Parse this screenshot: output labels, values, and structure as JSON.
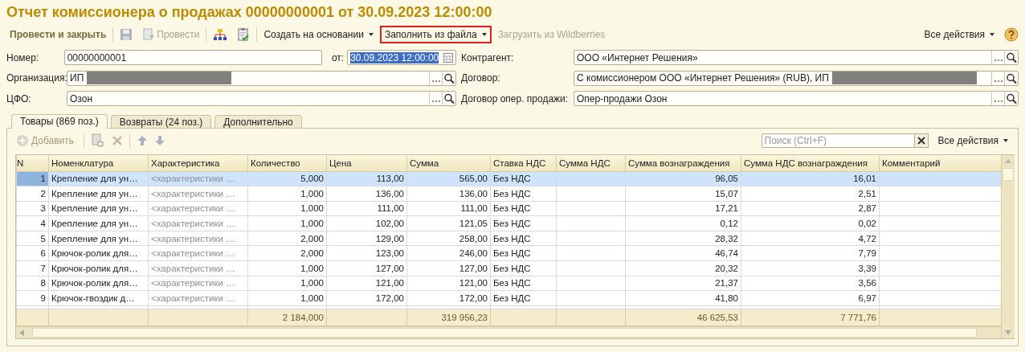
{
  "title": "Отчет комиссионера о продажах 00000000001 от 30.09.2023 12:00:00",
  "toolbar": {
    "items": [
      {
        "kind": "primary",
        "label": "Провести и закрыть",
        "disabled": false,
        "highlighted": false
      },
      {
        "kind": "save",
        "disabled": true,
        "highlighted": false
      },
      {
        "kind": "post",
        "label": "Провести",
        "disabled": true,
        "highlighted": false
      },
      {
        "kind": "structure",
        "disabled": false,
        "highlighted": false
      },
      {
        "kind": "report",
        "disabled": false,
        "highlighted": false
      },
      {
        "kind": "menu",
        "label": "Создать на основании",
        "disabled": false,
        "highlighted": false
      },
      {
        "kind": "menu",
        "label": "Заполнить из файла",
        "disabled": false,
        "highlighted": true
      },
      {
        "kind": "link",
        "label": "Загрузить из Wildberries",
        "disabled": true,
        "highlighted": false
      }
    ],
    "all_actions": "Все действия"
  },
  "fields_left": [
    {
      "label": "Номер:",
      "value": "00000000001",
      "kind": "number",
      "date_label": "от:",
      "date_value": "30.09.2023 12:00:00",
      "date_selected": true
    },
    {
      "label": "Организация:",
      "value": "ИП",
      "kind": "ref",
      "redacted": true
    },
    {
      "label": "ЦФО:",
      "value": "Озон",
      "kind": "ref",
      "redacted": false
    }
  ],
  "fields_right": [
    {
      "label": "Контрагент:",
      "value": "ООО «Интернет Решения»",
      "redacted": false
    },
    {
      "label": "Договор:",
      "value": "С комиссионером ООО «Интернет Решения» (RUB), ИП",
      "redacted": true
    },
    {
      "label": "Договор опер. продажи:",
      "value": "Опер-продажи Озон",
      "redacted": false
    }
  ],
  "tabs": [
    {
      "label": "Товары (869 поз.)",
      "selected": true
    },
    {
      "label": "Возвраты (24 поз.)",
      "selected": false
    },
    {
      "label": "Дополнительно",
      "selected": false
    }
  ],
  "table_toolbar": {
    "add": {
      "label": "Добавить",
      "disabled": true
    },
    "icons": [
      {
        "kind": "copy",
        "disabled": true
      },
      {
        "kind": "delete",
        "disabled": true
      },
      {
        "kind": "up",
        "disabled": true
      },
      {
        "kind": "down",
        "disabled": true
      }
    ],
    "search": {
      "placeholder": "Поиск (Ctrl+F)"
    },
    "all_actions": "Все действия"
  },
  "table": {
    "columns": [
      {
        "label": "N",
        "kind": "index"
      },
      {
        "label": "Номенклатура",
        "kind": "text"
      },
      {
        "label": "Характеристика",
        "kind": "hint"
      },
      {
        "label": "Количество",
        "kind": "number",
        "total": "2 184,000"
      },
      {
        "label": "Цена",
        "kind": "number"
      },
      {
        "label": "Сумма",
        "kind": "number",
        "total": "319 956,23"
      },
      {
        "label": "Ставка НДС",
        "kind": "text"
      },
      {
        "label": "Сумма НДС",
        "kind": "number"
      },
      {
        "label": "Сумма вознаграждения",
        "kind": "number",
        "total": "46 625,53"
      },
      {
        "label": "Сумма НДС вознаграждения",
        "kind": "number",
        "total": "7 771,76"
      },
      {
        "label": "Комментарий",
        "kind": "text"
      }
    ],
    "rows": [
      {
        "selected": true,
        "cells": [
          "1",
          "Крепление для ун…",
          "<характеристики …",
          "5,000",
          "113,00",
          "565,00",
          "Без НДС",
          "",
          "96,05",
          "16,01",
          ""
        ]
      },
      {
        "selected": false,
        "cells": [
          "2",
          "Крепление для ун…",
          "<характеристики …",
          "1,000",
          "136,00",
          "136,00",
          "Без НДС",
          "",
          "15,07",
          "2,51",
          ""
        ]
      },
      {
        "selected": false,
        "cells": [
          "3",
          "Крепление для ун…",
          "<характеристики …",
          "1,000",
          "111,00",
          "111,00",
          "Без НДС",
          "",
          "17,21",
          "2,87",
          ""
        ]
      },
      {
        "selected": false,
        "cells": [
          "4",
          "Крепление для ун…",
          "<характеристики …",
          "1,000",
          "102,00",
          "121,05",
          "Без НДС",
          "",
          "0,12",
          "0,02",
          ""
        ]
      },
      {
        "selected": false,
        "cells": [
          "5",
          "Крепление для ун…",
          "<характеристики …",
          "2,000",
          "129,00",
          "258,00",
          "Без НДС",
          "",
          "28,32",
          "4,72",
          ""
        ]
      },
      {
        "selected": false,
        "cells": [
          "6",
          "Крючок-ролик для…",
          "<характеристики …",
          "2,000",
          "123,00",
          "246,00",
          "Без НДС",
          "",
          "46,74",
          "7,79",
          ""
        ]
      },
      {
        "selected": false,
        "cells": [
          "7",
          "Крючок-ролик для…",
          "<характеристики …",
          "1,000",
          "127,00",
          "127,00",
          "Без НДС",
          "",
          "20,32",
          "3,39",
          ""
        ]
      },
      {
        "selected": false,
        "cells": [
          "8",
          "Крючок-ролик для…",
          "<характеристики …",
          "1,000",
          "121,00",
          "121,00",
          "Без НДС",
          "",
          "21,37",
          "3,56",
          ""
        ]
      },
      {
        "selected": false,
        "cells": [
          "9",
          "Крючок-гвоздик д…",
          "<характеристики …",
          "1,000",
          "172,00",
          "172,00",
          "Без НДС",
          "",
          "41,80",
          "6,97",
          ""
        ]
      }
    ]
  }
}
